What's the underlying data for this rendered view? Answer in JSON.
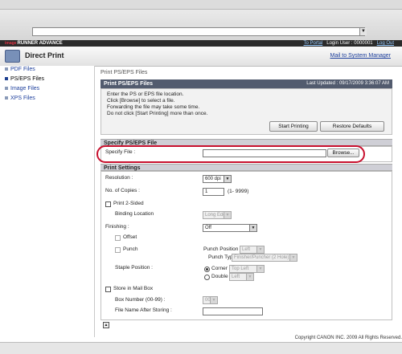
{
  "browser": {
    "address": "",
    "go": "▼"
  },
  "app": {
    "brand_small": "image",
    "brand_large": "RUNNER ADVANCE",
    "to_portal": "To Portal",
    "login_user_label": "Login User :",
    "login_user_value": "0000001",
    "logout": "Log Out",
    "title": "Direct Print",
    "mail_link": "Mail to System Manager"
  },
  "sidebar": {
    "items": [
      {
        "label": "PDF Files"
      },
      {
        "label": "PS/EPS Files"
      },
      {
        "label": "Image Files"
      },
      {
        "label": "XPS Files"
      }
    ]
  },
  "breadcrumb": "Print PS/EPS Files",
  "panel": {
    "title": "Print PS/EPS Files",
    "last_updated": "Last Updated : 09/17/2009 3:36:07 AM",
    "instructions": [
      "Enter the PS or EPS file location.",
      "Click [Browse] to select a file.",
      "Forwarding the file may take some time.",
      "Do not click [Start Printing] more than once."
    ],
    "start_printing": "Start Printing",
    "restore_defaults": "Restore Defaults"
  },
  "specify": {
    "section": "Specify PS/EPS File",
    "label": "Specify File :",
    "value": "",
    "browse": "Browse..."
  },
  "settings": {
    "section": "Print Settings",
    "resolution_label": "Resolution :",
    "resolution_value": "600 dpi",
    "copies_label": "No. of Copies :",
    "copies_value": "1",
    "copies_range": "(1- 9999)",
    "two_sided_label": "Print 2-Sided",
    "binding_label": "Binding Location",
    "binding_value": "Long Edge",
    "finishing_label": "Finishing :",
    "finishing_value": "Off",
    "offset_label": "Offset",
    "punch_label": "Punch",
    "punch_position_label": "Punch Position",
    "punch_position_value": "Left",
    "punch_type_label": "Punch Type",
    "punch_type_value": "Finisher/Puncher (2 Hole)",
    "staple_label": "Staple Position :",
    "corner_label": "Corner",
    "corner_value": "Top Left",
    "double_label": "Double",
    "double_value": "Left",
    "store_label": "Store in Mail Box",
    "box_number_label": "Box Number (00-99) :",
    "box_number_value": "00",
    "file_name_label": "File Name After Storing :",
    "file_name_value": ""
  },
  "footer": "Copyright CANON INC. 2009 All Rights Reserved."
}
